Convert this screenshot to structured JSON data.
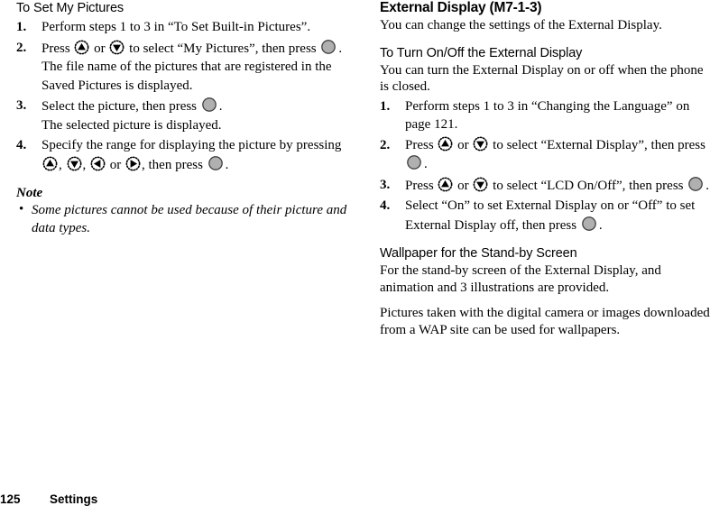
{
  "page": {
    "footer": {
      "page_number": "125",
      "chapter": "Settings"
    }
  },
  "left_column": {
    "heading": "To Set My Pictures",
    "steps": [
      {
        "num": "1.",
        "parts": [
          {
            "type": "text",
            "value": "Perform steps 1 to 3 in “To Set Built-in Pictures”."
          }
        ]
      },
      {
        "num": "2.",
        "parts": [
          {
            "type": "text",
            "value": "Press "
          },
          {
            "type": "icon",
            "icon": "key-up"
          },
          {
            "type": "text",
            "value": " or "
          },
          {
            "type": "icon",
            "icon": "key-down"
          },
          {
            "type": "text",
            "value": " to select “My Pictures”, then press "
          },
          {
            "type": "icon",
            "icon": "key-center"
          },
          {
            "type": "text",
            "value": "."
          }
        ],
        "note": "The file name of the pictures that are registered in the Saved Pictures is displayed."
      },
      {
        "num": "3.",
        "parts": [
          {
            "type": "text",
            "value": "Select the picture, then press "
          },
          {
            "type": "icon",
            "icon": "key-center"
          },
          {
            "type": "text",
            "value": "."
          }
        ],
        "note": "The selected picture is displayed."
      },
      {
        "num": "4.",
        "parts": [
          {
            "type": "text",
            "value": "Specify the range for displaying the picture by pressing "
          },
          {
            "type": "icon",
            "icon": "key-up"
          },
          {
            "type": "text",
            "value": ", "
          },
          {
            "type": "icon",
            "icon": "key-down"
          },
          {
            "type": "text",
            "value": ", "
          },
          {
            "type": "icon",
            "icon": "key-left"
          },
          {
            "type": "text",
            "value": " or "
          },
          {
            "type": "icon",
            "icon": "key-right"
          },
          {
            "type": "text",
            "value": ", then press "
          },
          {
            "type": "icon",
            "icon": "key-center"
          },
          {
            "type": "text",
            "value": "."
          }
        ]
      }
    ],
    "note": {
      "title": "Note",
      "bullet_char": "•",
      "items": [
        "Some pictures cannot be used because of their picture and data types."
      ]
    }
  },
  "right_column": {
    "heading": "External Display (M7-1-3)",
    "intro": "You can change the settings of the External Display.",
    "section1": {
      "heading": "To Turn On/Off the External Display",
      "intro": "You can turn the External Display on or off when the phone is closed.",
      "steps": [
        {
          "num": "1.",
          "parts": [
            {
              "type": "text",
              "value": "Perform steps 1 to 3 in “Changing the Language” on page 121."
            }
          ]
        },
        {
          "num": "2.",
          "parts": [
            {
              "type": "text",
              "value": "Press "
            },
            {
              "type": "icon",
              "icon": "key-up"
            },
            {
              "type": "text",
              "value": " or "
            },
            {
              "type": "icon",
              "icon": "key-down"
            },
            {
              "type": "text",
              "value": " to select “External Display”, then press "
            },
            {
              "type": "icon",
              "icon": "key-center"
            },
            {
              "type": "text",
              "value": "."
            }
          ]
        },
        {
          "num": "3.",
          "parts": [
            {
              "type": "text",
              "value": "Press "
            },
            {
              "type": "icon",
              "icon": "key-up"
            },
            {
              "type": "text",
              "value": " or "
            },
            {
              "type": "icon",
              "icon": "key-down"
            },
            {
              "type": "text",
              "value": " to select “LCD On/Off”, then press "
            },
            {
              "type": "icon",
              "icon": "key-center"
            },
            {
              "type": "text",
              "value": "."
            }
          ]
        },
        {
          "num": "4.",
          "parts": [
            {
              "type": "text",
              "value": "Select “On” to set External Display on or “Off” to set External Display off, then press "
            },
            {
              "type": "icon",
              "icon": "key-center"
            },
            {
              "type": "text",
              "value": "."
            }
          ]
        }
      ]
    },
    "section2": {
      "heading": "Wallpaper for the Stand-by Screen",
      "paragraphs": [
        "For the stand-by screen of the External Display, and animation and 3 illustrations are provided.",
        "Pictures taken with the digital camera or images downloaded from a WAP site can be used for wallpapers."
      ]
    }
  },
  "colors": {
    "text": "#000000",
    "background": "#ffffff",
    "key_fill": "#b0b0b0",
    "key_stroke": "#3a3a3a",
    "icon_glyph": "#000000"
  }
}
